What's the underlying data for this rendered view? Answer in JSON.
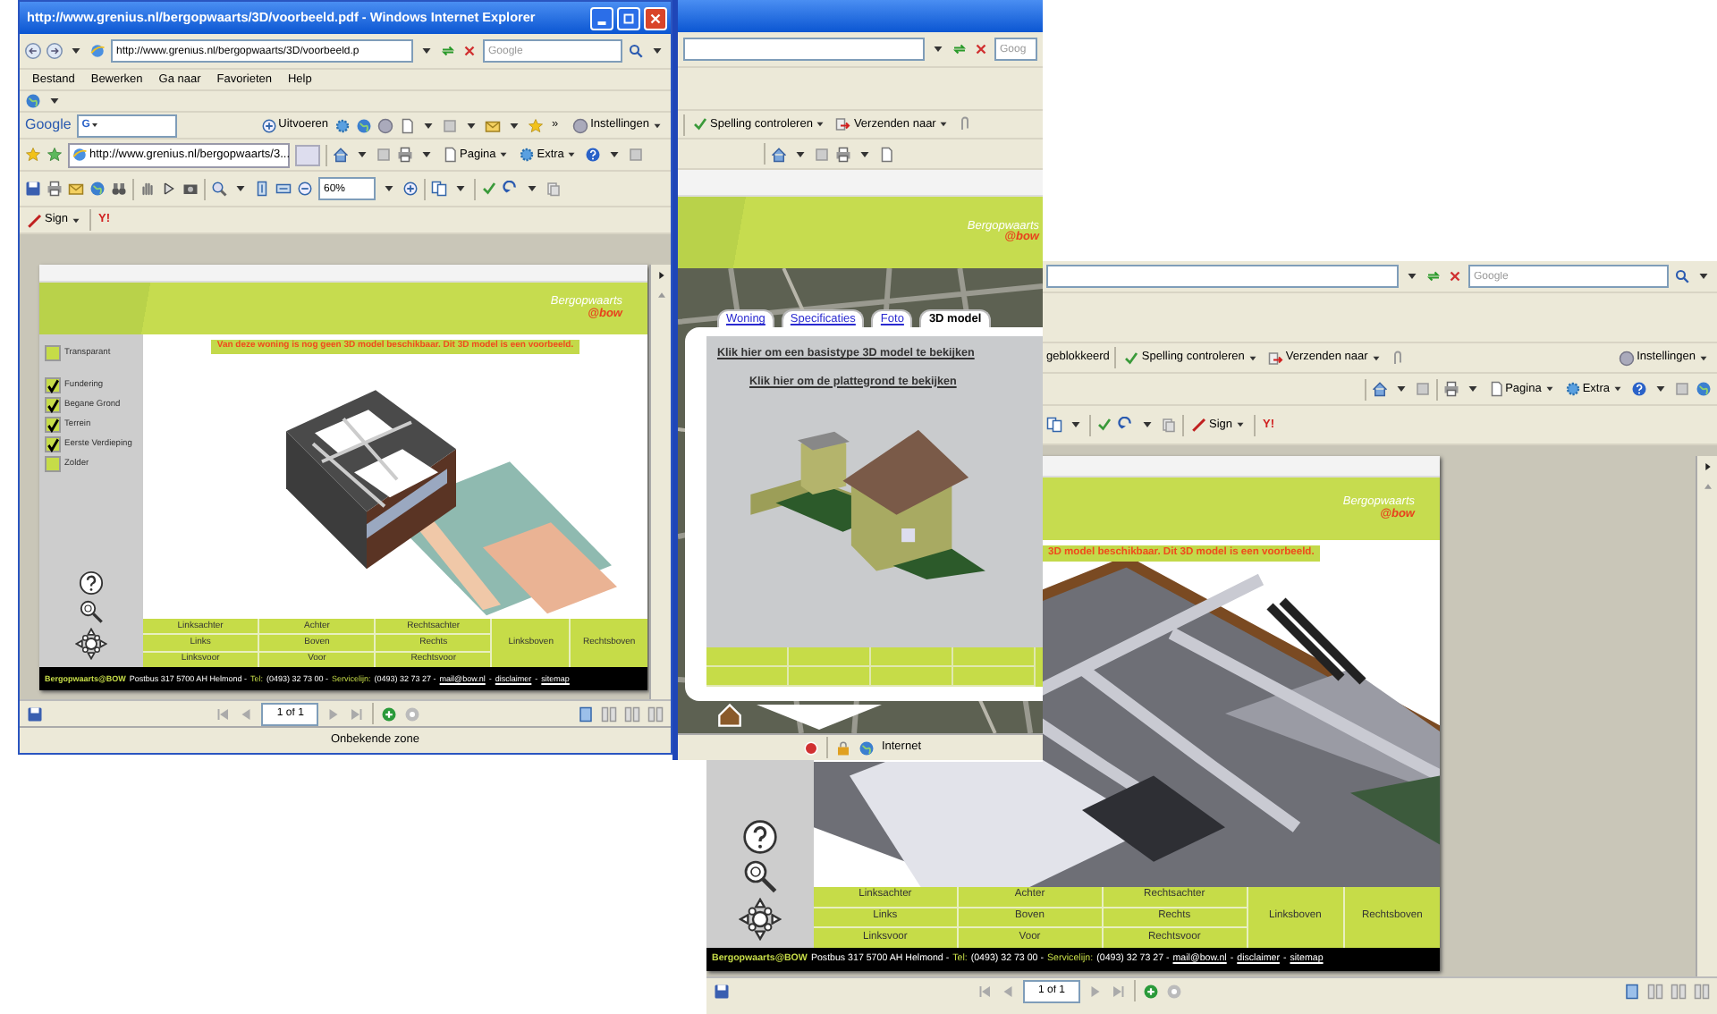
{
  "left_window": {
    "title": "http://www.grenius.nl/bergopwaarts/3D/voorbeeld.pdf - Windows Internet Explorer",
    "address": "http://www.grenius.nl/bergopwaarts/3D/voorbeeld.p",
    "search_placeholder": "Google",
    "menu": [
      "Bestand",
      "Bewerken",
      "Ga naar",
      "Favorieten",
      "Help"
    ],
    "google_logo": "Google",
    "google_field_logo": "G",
    "google_run": "Uitvoeren",
    "google_more": "»",
    "google_settings": "Instellingen",
    "tab": "http://www.grenius.nl/bergopwaarts/3...",
    "commands": [
      "Pagina",
      "Extra"
    ],
    "zoom": "60%",
    "sign": "Sign",
    "toolbar_logo": "Y!",
    "page": {
      "logo": "Bergopwaarts",
      "logo_tag": "@bow",
      "layers": [
        {
          "label": "Transparant",
          "checked": false
        },
        {
          "label": "Fundering",
          "checked": true
        },
        {
          "label": "Begane Grond",
          "checked": true
        },
        {
          "label": "Terrein",
          "checked": true
        },
        {
          "label": "Eerste Verdieping",
          "checked": true
        },
        {
          "label": "Zolder",
          "checked": false
        }
      ],
      "notice": "Van deze woning is nog geen 3D model beschikbaar. Dit 3D model is een voorbeeld.",
      "views": [
        [
          "Linksachter",
          "Achter",
          "Rechtsachter"
        ],
        [
          "Links",
          "Boven",
          "Rechts"
        ],
        [
          "Linksvoor",
          "Voor",
          "Rechtsvoor"
        ]
      ],
      "upper_views": [
        "Linksboven",
        "Rechtsboven"
      ],
      "footer": [
        {
          "text": "Bergopwaarts@BOW",
          "kind": "brand"
        },
        {
          "text": "Postbus 317 5700 AH Helmond -",
          "kind": "plain"
        },
        {
          "text": "Tel:",
          "kind": "label"
        },
        {
          "text": "(0493) 32 73 00 -",
          "kind": "plain"
        },
        {
          "text": "Servicelijn:",
          "kind": "label"
        },
        {
          "text": "(0493) 32 73 27 -",
          "kind": "plain"
        },
        {
          "text": "mail@bow.nl",
          "kind": "link"
        },
        {
          "text": "-",
          "kind": "plain"
        },
        {
          "text": "disclaimer",
          "kind": "link"
        },
        {
          "text": "-",
          "kind": "plain"
        },
        {
          "text": "sitemap",
          "kind": "link"
        }
      ]
    },
    "pager": "1 of 1",
    "status": "Onbekende zone"
  },
  "middle_window": {
    "search_placeholder": "Goog",
    "toolbar": [
      "Spelling controleren",
      "Verzenden naar"
    ],
    "logo": "Bergopwaarts",
    "logo_tag": "@bow",
    "tabs": [
      {
        "label": "Woning",
        "selected": false
      },
      {
        "label": "Specificaties",
        "selected": false
      },
      {
        "label": "Foto",
        "selected": false
      },
      {
        "label": "3D model",
        "selected": true
      }
    ],
    "links": [
      "Klik hier om een basistype 3D model te bekijken",
      "Klik hier om de plattegrond te bekijken"
    ],
    "status": "Internet"
  },
  "right_window": {
    "search_placeholder": "Google",
    "blocked": "geblokkeerd",
    "toolbar": [
      "Spelling controleren",
      "Verzenden naar"
    ],
    "settings": "Instellingen",
    "commands": [
      "Pagina",
      "Extra"
    ],
    "sign": "Sign",
    "toolbar_logo": "Y!",
    "page": {
      "logo": "Bergopwaarts",
      "logo_tag": "@bow",
      "notice": "3D model beschikbaar. Dit 3D model is een voorbeeld.",
      "views": [
        [
          "Linksachter",
          "Achter",
          "Rechtsachter"
        ],
        [
          "Links",
          "Boven",
          "Rechts"
        ],
        [
          "Linksvoor",
          "Voor",
          "Rechtsvoor"
        ]
      ],
      "upper_views": [
        "Linksboven",
        "Rechtsboven"
      ],
      "footer": [
        {
          "text": "Bergopwaarts@BOW",
          "kind": "brand"
        },
        {
          "text": "Postbus 317 5700 AH Helmond -",
          "kind": "plain"
        },
        {
          "text": "Tel:",
          "kind": "label"
        },
        {
          "text": "(0493) 32 73 00 -",
          "kind": "plain"
        },
        {
          "text": "Servicelijn:",
          "kind": "label"
        },
        {
          "text": "(0493) 32 73 27 -",
          "kind": "plain"
        },
        {
          "text": "mail@bow.nl",
          "kind": "link"
        },
        {
          "text": "-",
          "kind": "plain"
        },
        {
          "text": "disclaimer",
          "kind": "link"
        },
        {
          "text": "-",
          "kind": "plain"
        },
        {
          "text": "sitemap",
          "kind": "link"
        }
      ]
    },
    "pager": "1 of 1"
  }
}
